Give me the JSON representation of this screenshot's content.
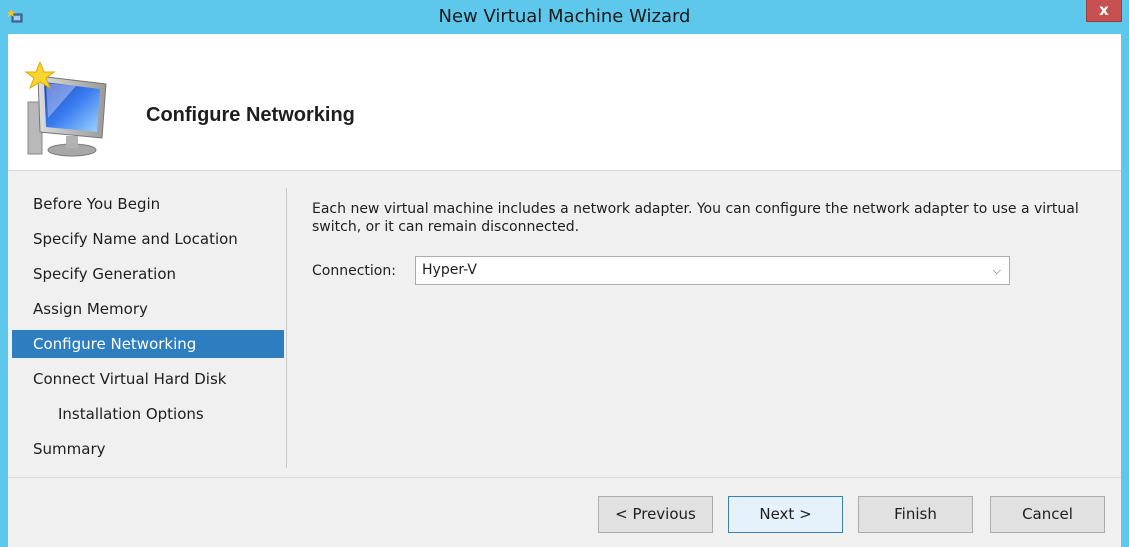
{
  "window": {
    "title": "New Virtual Machine Wizard",
    "close_label": "x"
  },
  "header": {
    "title": "Configure Networking"
  },
  "nav": {
    "items": [
      {
        "label": "Before You Begin"
      },
      {
        "label": "Specify Name and Location"
      },
      {
        "label": "Specify Generation"
      },
      {
        "label": "Assign Memory"
      },
      {
        "label": "Configure Networking",
        "active": true
      },
      {
        "label": "Connect Virtual Hard Disk"
      },
      {
        "label": "Installation Options",
        "indent": true
      },
      {
        "label": "Summary"
      }
    ]
  },
  "main": {
    "description": "Each new virtual machine includes a network adapter. You can configure the network adapter to use a virtual switch, or it can remain disconnected.",
    "connection_label": "Connection:",
    "connection_value": "Hyper-V"
  },
  "buttons": {
    "previous": "< Previous",
    "next": "Next >",
    "finish": "Finish",
    "cancel": "Cancel"
  },
  "colors": {
    "titlebar": "#5ec8ec",
    "nav_active": "#2d7dc1",
    "close": "#c75050"
  }
}
